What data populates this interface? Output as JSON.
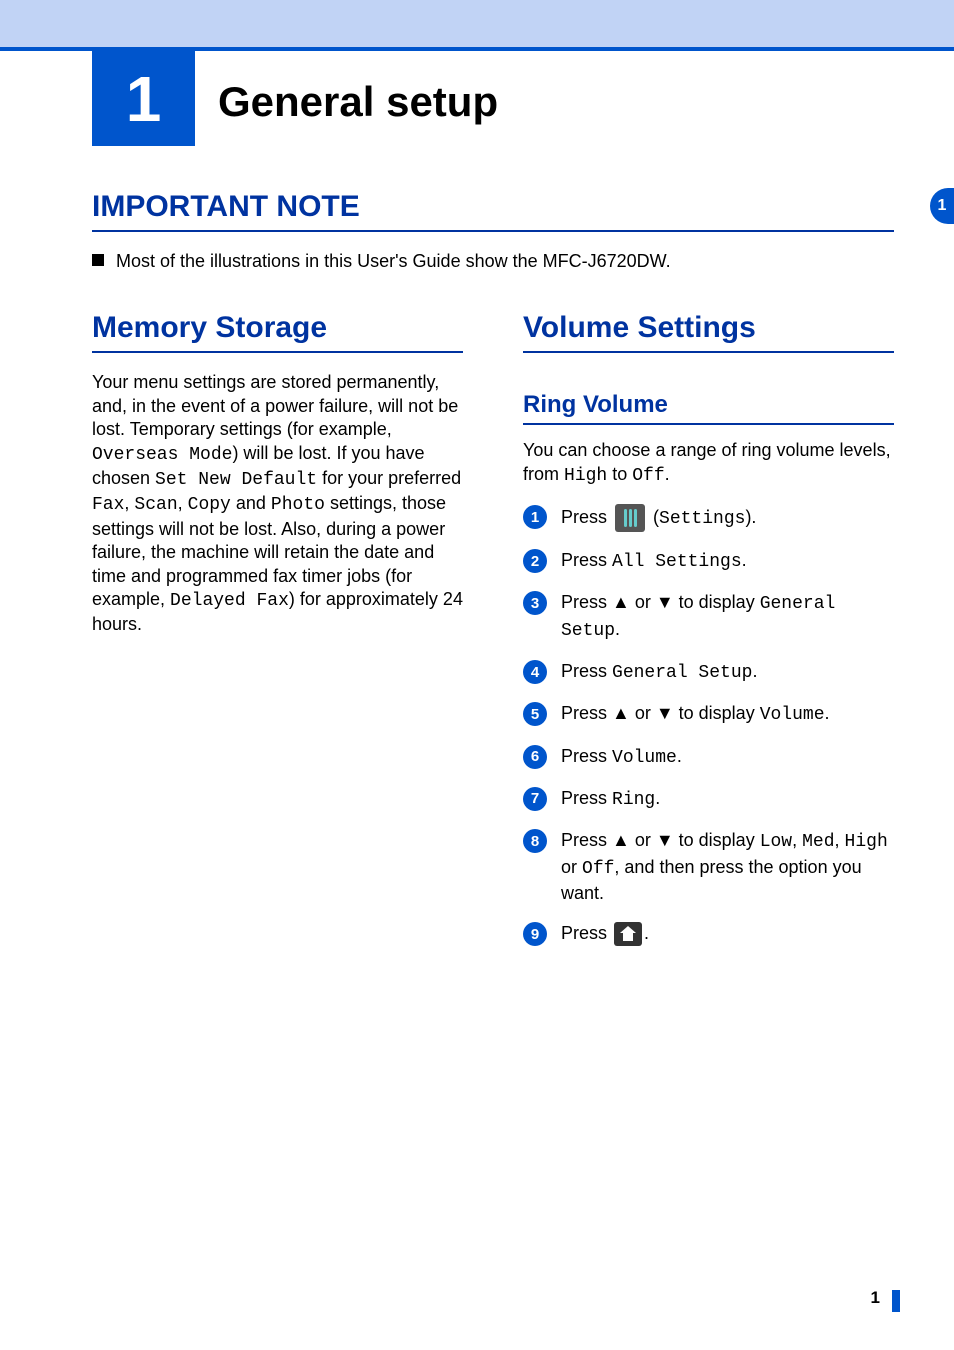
{
  "chapter": {
    "number": "1",
    "title": "General setup"
  },
  "side_tab": "1",
  "important_note": {
    "heading": "IMPORTANT NOTE",
    "bullet": "Most of the illustrations in this User's Guide show the MFC-J6720DW."
  },
  "memory_storage": {
    "heading": "Memory Storage",
    "para_1": "Your menu settings are stored permanently, and, in the event of a power failure, will not be lost. Temporary settings (for example, ",
    "mono_1": "Overseas Mode",
    "para_2": ") will be lost. If you have chosen ",
    "mono_2": "Set New Default",
    "para_3": " for your preferred ",
    "mono_3": "Fax",
    "para_4": ", ",
    "mono_4": "Scan",
    "para_5": ", ",
    "mono_5": "Copy",
    "para_6": " and ",
    "mono_6": "Photo",
    "para_7": " settings, those settings will not be lost. Also, during a power failure, the machine will retain the date and time and programmed fax timer jobs (for example, ",
    "mono_7": "Delayed Fax",
    "para_8": ") for approximately 24 hours."
  },
  "volume_settings": {
    "heading": "Volume Settings",
    "ring_volume_heading": "Ring Volume",
    "intro_1": "You can choose a range of ring volume levels, from ",
    "intro_mono_1": "High",
    "intro_2": " to ",
    "intro_mono_2": "Off",
    "intro_3": ".",
    "steps": {
      "s1_a": "Press ",
      "s1_b": " (",
      "s1_mono": "Settings",
      "s1_c": ").",
      "s2_a": "Press ",
      "s2_mono": "All Settings",
      "s2_b": ".",
      "s3_a": "Press ▲ or ▼ to display ",
      "s3_mono": "General Setup",
      "s3_b": ".",
      "s4_a": "Press ",
      "s4_mono": "General Setup",
      "s4_b": ".",
      "s5_a": "Press ▲ or ▼ to display ",
      "s5_mono": "Volume",
      "s5_b": ".",
      "s6_a": "Press ",
      "s6_mono": "Volume",
      "s6_b": ".",
      "s7_a": "Press ",
      "s7_mono": "Ring",
      "s7_b": ".",
      "s8_a": "Press ▲ or ▼ to display ",
      "s8_mono_1": "Low",
      "s8_b": ", ",
      "s8_mono_2": "Med",
      "s8_c": ", ",
      "s8_mono_3": "High",
      "s8_d": " or ",
      "s8_mono_4": "Off",
      "s8_e": ", and then press the option you want.",
      "s9_a": "Press ",
      "s9_b": "."
    }
  },
  "page_number": "1"
}
